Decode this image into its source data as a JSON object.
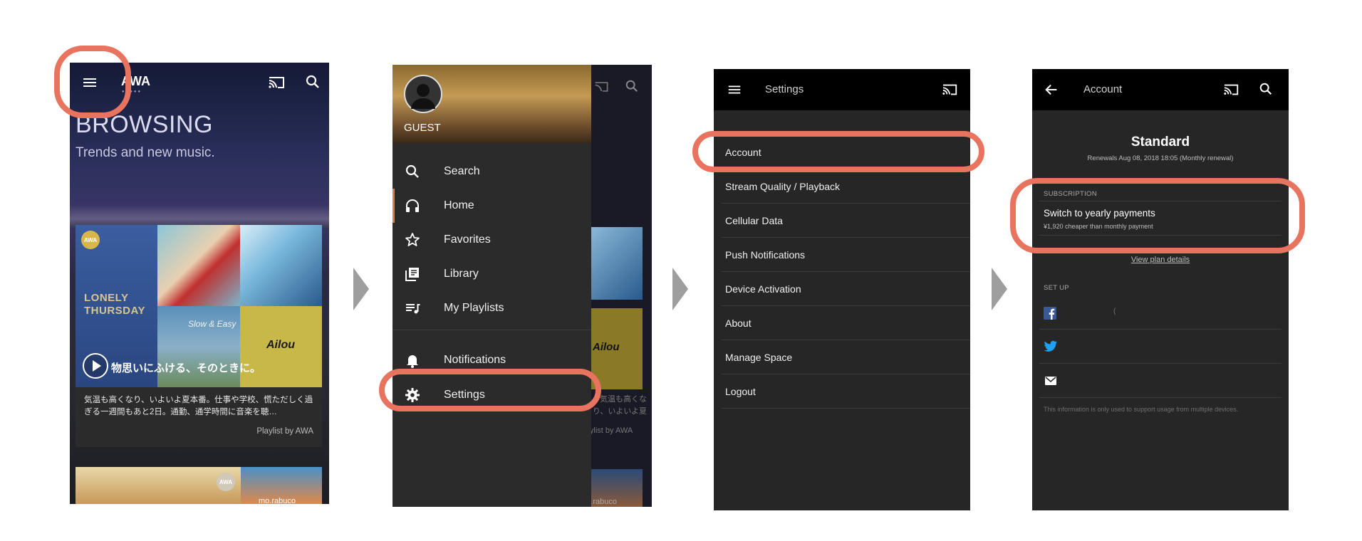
{
  "screens": {
    "browsing": {
      "app_logo": "AWA",
      "title": "BROWSING",
      "subtitle": "Trends and new music.",
      "card": {
        "badge": "AWA",
        "cover_text": "LONELY THURSDAY",
        "tile_text_1": "Slow & Easy",
        "tile_text_2": "Ailou",
        "playlist_title": "物思いにふける、そのときに。",
        "description": "気温も高くなり、いよいよ夏本番。仕事や学校、慌ただしく過ぎる一週間もあと2日。通勤、通学時間に音楽を聴…",
        "byline": "Playlist by AWA"
      },
      "bottom_badge": "AWA",
      "bottom_tile_text": "mo.rabuco"
    },
    "drawer": {
      "user": "GUEST",
      "items": [
        {
          "label": "Search",
          "icon": "search-icon"
        },
        {
          "label": "Home",
          "icon": "headphones-icon"
        },
        {
          "label": "Favorites",
          "icon": "star-icon"
        },
        {
          "label": "Library",
          "icon": "library-icon"
        },
        {
          "label": "My Playlists",
          "icon": "playlist-icon"
        },
        {
          "label": "Notifications",
          "icon": "bell-icon"
        },
        {
          "label": "Settings",
          "icon": "gear-icon"
        }
      ],
      "behind_text": "気温も高くなり、いよいよ夏本番。仕事や学校、慌ただしく過ぎる一週間もあと2日。通勤、通学時間に音楽を聴…",
      "behind_byline": "Playlist by AWA",
      "behind_tile_text": "Ailou",
      "behind_bottom_text": "mo.rabuco"
    },
    "settings": {
      "title": "Settings",
      "items": [
        "Account",
        "Stream Quality / Playback",
        "Cellular Data",
        "Push Notifications",
        "Device Activation",
        "About",
        "Manage Space",
        "Logout"
      ]
    },
    "account": {
      "title": "Account",
      "plan": "Standard",
      "renewal": "Renewals Aug 08, 2018 18:05 (Monthly renewal)",
      "subscription_header": "SUBSCRIPTION",
      "switch_label": "Switch to yearly payments",
      "switch_sub": "¥1,920 cheaper than monthly payment",
      "view_plan": "View plan details",
      "setup_header": "SET UP",
      "facebook_partial": "(",
      "footnote": "This information is only used to support usage from multiple devices."
    }
  },
  "colors": {
    "highlight": "#e8735e",
    "arrow": "#9e9e9e",
    "panel_dark": "#262626",
    "appbar": "#000000"
  }
}
